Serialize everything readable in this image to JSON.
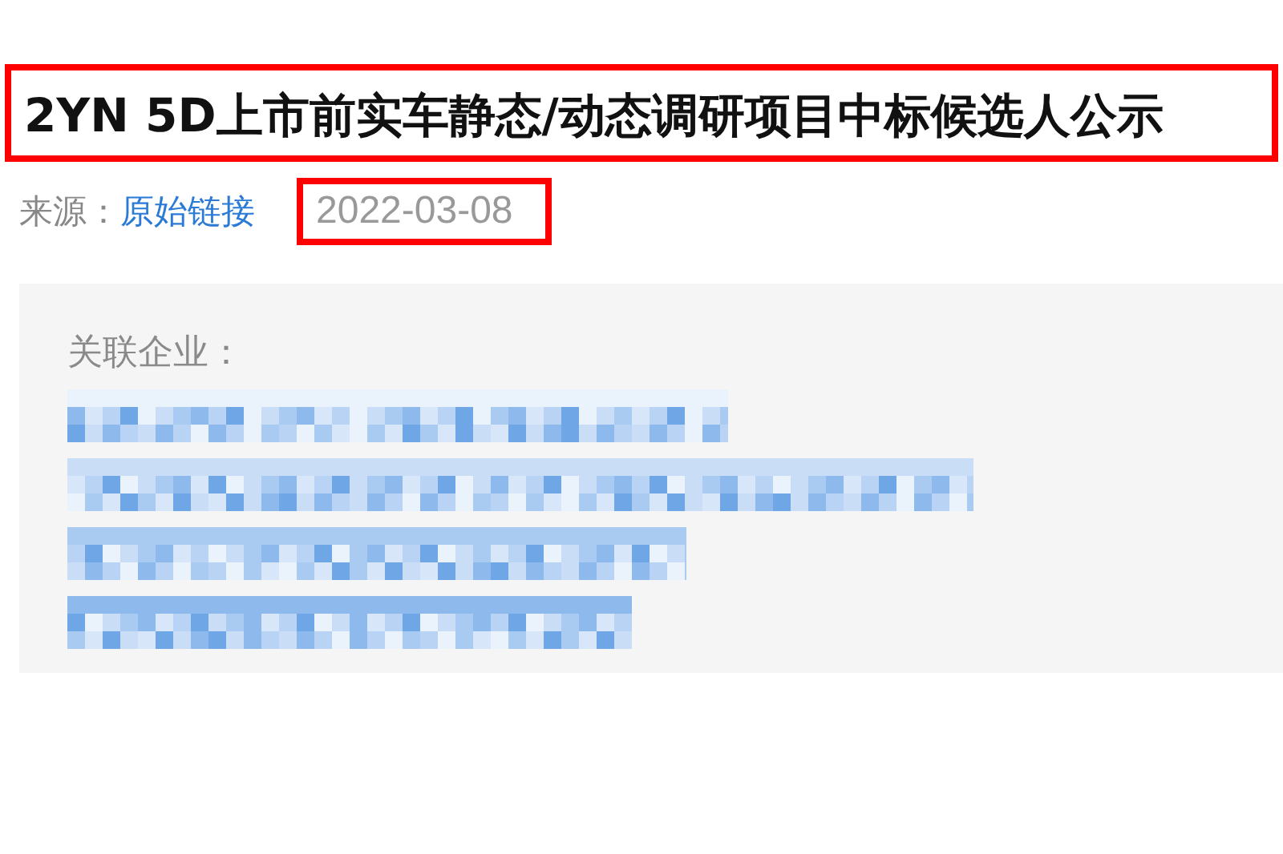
{
  "article": {
    "title": "2YN 5D上市前实车静态/动态调研项目中标候选人公示",
    "title_highlighted": true,
    "source_label": "来源：",
    "source_link": "原始链接",
    "date": "2022-03-08",
    "date_highlighted": true
  },
  "related_companies": {
    "label": "关联企业：",
    "items": [
      {
        "kind": "pixelated"
      },
      {
        "kind": "pixelated"
      },
      {
        "kind": "pixelated"
      },
      {
        "kind": "pixelated"
      }
    ]
  }
}
